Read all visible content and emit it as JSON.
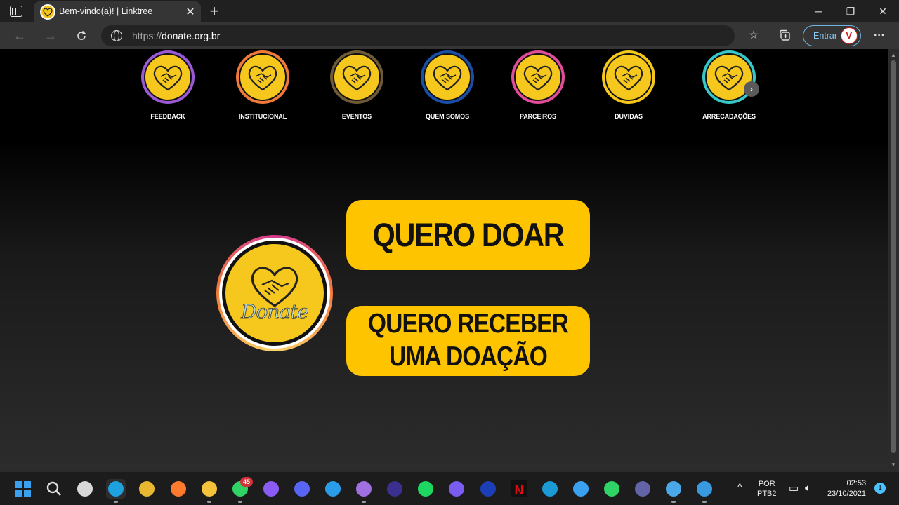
{
  "browser": {
    "tab_title": "Bem-vindo(a)! | Linktree",
    "new_tab_symbol": "+",
    "close_tab_symbol": "✕",
    "window_controls": [
      "─",
      "❐",
      "✕"
    ],
    "url_protocol": "https://",
    "url_domain": "donate.org.br",
    "signin_label": "Entrar",
    "more_symbol": "···"
  },
  "stories": [
    {
      "label": "FEEDBACK",
      "ring": "#9b59d6"
    },
    {
      "label": "INSTITUCIONAL",
      "ring": "#f07a3a"
    },
    {
      "label": "EVENTOS",
      "ring": "#6e5a36"
    },
    {
      "label": "QUEM SOMOS",
      "ring": "#1a4fa8"
    },
    {
      "label": "PARCEIROS",
      "ring": "#e24d9a"
    },
    {
      "label": "DUVIDAS",
      "ring": "#f6c81d"
    },
    {
      "label": "ARRECADAÇÕES",
      "ring": "#37c9c9"
    }
  ],
  "carousel_next_symbol": "›",
  "logo_text": "Donate",
  "cta": {
    "donate": "QUERO DOAR",
    "receive_line1": "QUERO RECEBER",
    "receive_line2": "UMA DOAÇÃO"
  },
  "taskbar": {
    "whatsapp_badge": "45",
    "lang_line1": "POR",
    "lang_line2": "PTB2",
    "time": "02:53",
    "date": "23/10/2021",
    "notification_count": "1",
    "apps": [
      "start",
      "search",
      "task-view",
      "edge",
      "chrome",
      "firefox",
      "file-explorer",
      "whatsapp",
      "messenger",
      "discord",
      "vscode",
      "github",
      "amazon-music",
      "spotify",
      "mastodon",
      "disney-plus",
      "netflix",
      "prime-video",
      "azure",
      "whatsapp-desktop",
      "teams",
      "snipping-tool",
      "photos"
    ]
  }
}
